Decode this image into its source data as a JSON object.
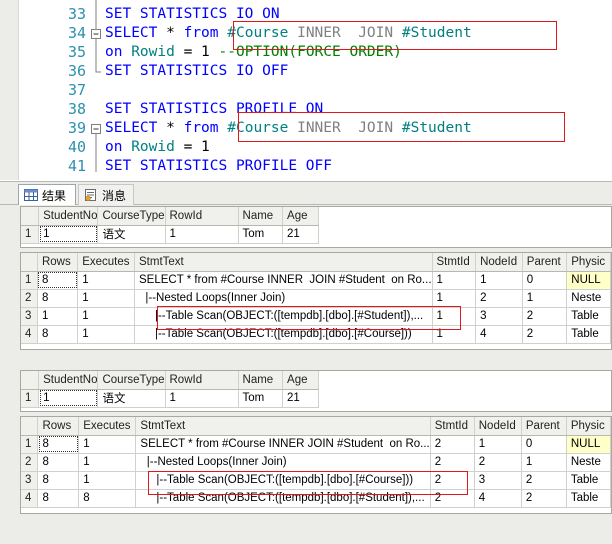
{
  "editor": {
    "lines": [
      {
        "num": "33",
        "tokens": [
          [
            "kw",
            "SET STATISTICS IO ON"
          ]
        ]
      },
      {
        "num": "34",
        "tokens": [
          [
            "kw",
            "SELECT"
          ],
          [
            "tx",
            " * "
          ],
          [
            "kw",
            "from "
          ],
          [
            "tn",
            "#Course "
          ],
          [
            "gy",
            "INNER  JOIN "
          ],
          [
            "tn",
            "#Student"
          ]
        ]
      },
      {
        "num": "35",
        "tokens": [
          [
            "kw",
            "on "
          ],
          [
            "tn",
            "Rowid"
          ],
          [
            "tx",
            " = 1 "
          ],
          [
            "cm",
            "--OPTION(FORCE ORDER)"
          ]
        ]
      },
      {
        "num": "36",
        "tokens": [
          [
            "kw",
            "SET STATISTICS IO OFF"
          ]
        ]
      },
      {
        "num": "37",
        "tokens": []
      },
      {
        "num": "38",
        "tokens": [
          [
            "kw",
            "SET STATISTICS PROFILE ON"
          ]
        ]
      },
      {
        "num": "39",
        "tokens": [
          [
            "kw",
            "SELECT"
          ],
          [
            "tx",
            " * "
          ],
          [
            "kw",
            "from "
          ],
          [
            "tn",
            "#Course "
          ],
          [
            "gy",
            "INNER  JOIN "
          ],
          [
            "tn",
            "#Student"
          ]
        ]
      },
      {
        "num": "40",
        "tokens": [
          [
            "kw",
            "on "
          ],
          [
            "tn",
            "Rowid"
          ],
          [
            "tx",
            " = 1"
          ]
        ]
      },
      {
        "num": "41",
        "tokens": [
          [
            "kw",
            "SET STATISTICS PROFILE OFF"
          ]
        ]
      }
    ]
  },
  "tabs": {
    "results_label": "结果",
    "messages_label": "消息"
  },
  "grids": [
    {
      "id": "result1",
      "columns": [
        "StudentNo",
        "CourseType",
        "RowId",
        "Name",
        "Age"
      ],
      "rows": [
        {
          "rn": "1",
          "cells": [
            "1",
            "语文",
            "1",
            "Tom",
            "21"
          ]
        }
      ]
    },
    {
      "id": "profile1",
      "columns": [
        "Rows",
        "Executes",
        "StmtText",
        "StmtId",
        "NodeId",
        "Parent",
        "Physic"
      ],
      "rows": [
        {
          "rn": "1",
          "cells": [
            "8",
            "1",
            "SELECT * from #Course INNER  JOIN #Student  on Ro...",
            "1",
            "1",
            "0",
            "NULL"
          ]
        },
        {
          "rn": "2",
          "cells": [
            "8",
            "1",
            "  |--Nested Loops(Inner Join)",
            "1",
            "2",
            "1",
            "Neste"
          ]
        },
        {
          "rn": "3",
          "cells": [
            "1",
            "1",
            "     |--Table Scan(OBJECT:([tempdb].[dbo].[#Student]),...",
            "1",
            "3",
            "2",
            "Table"
          ]
        },
        {
          "rn": "4",
          "cells": [
            "8",
            "1",
            "     |--Table Scan(OBJECT:([tempdb].[dbo].[#Course]))",
            "1",
            "4",
            "2",
            "Table"
          ]
        }
      ]
    },
    {
      "id": "result2",
      "columns": [
        "StudentNo",
        "CourseType",
        "RowId",
        "Name",
        "Age"
      ],
      "rows": [
        {
          "rn": "1",
          "cells": [
            "1",
            "语文",
            "1",
            "Tom",
            "21"
          ]
        }
      ]
    },
    {
      "id": "profile2",
      "columns": [
        "Rows",
        "Executes",
        "StmtText",
        "StmtId",
        "NodeId",
        "Parent",
        "Physic"
      ],
      "rows": [
        {
          "rn": "1",
          "cells": [
            "8",
            "1",
            "SELECT * from #Course INNER JOIN #Student  on Ro...",
            "2",
            "1",
            "0",
            "NULL"
          ]
        },
        {
          "rn": "2",
          "cells": [
            "8",
            "1",
            "  |--Nested Loops(Inner Join)",
            "2",
            "2",
            "1",
            "Neste"
          ]
        },
        {
          "rn": "3",
          "cells": [
            "8",
            "1",
            "     |--Table Scan(OBJECT:([tempdb].[dbo].[#Course]))",
            "2",
            "3",
            "2",
            "Table"
          ]
        },
        {
          "rn": "4",
          "cells": [
            "8",
            "8",
            "     |--Table Scan(OBJECT:([tempdb].[dbo].[#Student]),...",
            "2",
            "4",
            "2",
            "Table"
          ]
        }
      ]
    }
  ],
  "colors": {
    "keyword": "#0000ff",
    "table_name": "#008080",
    "comment": "#008000",
    "line_number": "#2b91af",
    "highlight_box": "#e0181c",
    "null_cell": "#ffffc8"
  }
}
